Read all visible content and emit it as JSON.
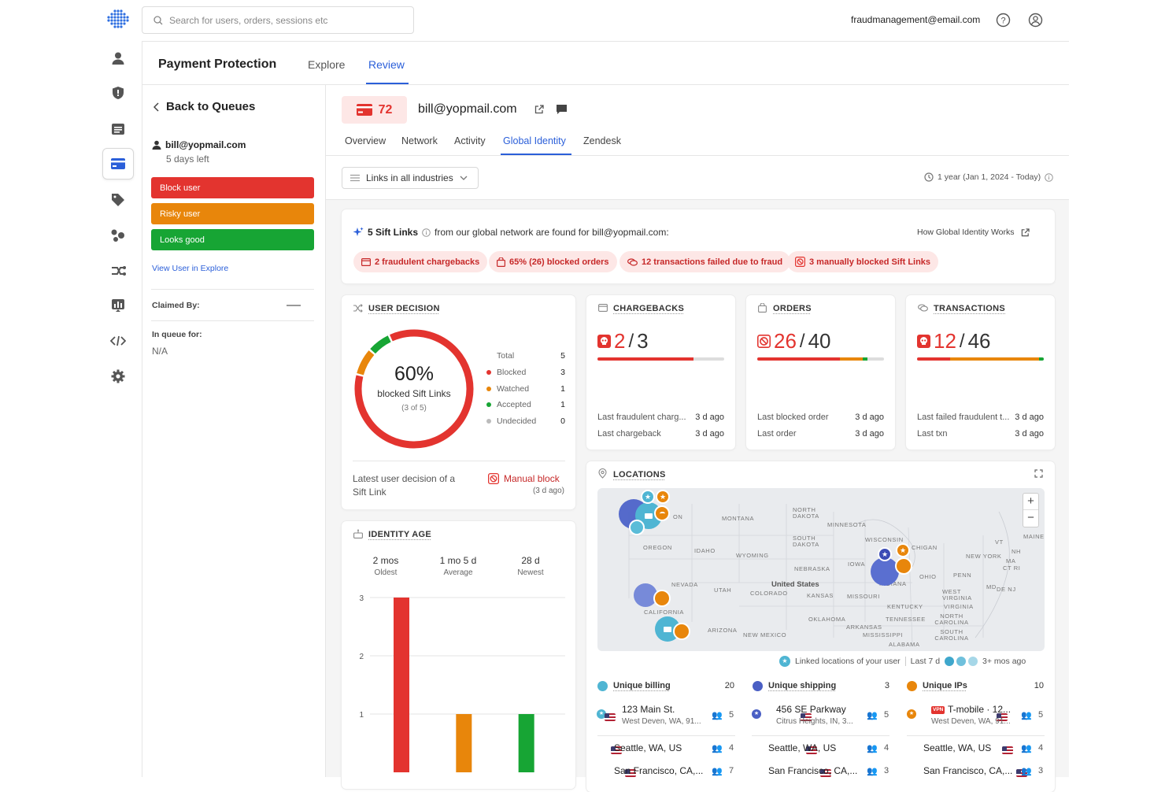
{
  "header": {
    "search_placeholder": "Search for users, orders, sessions etc",
    "account_email": "fraudmanagement@email.com"
  },
  "nav": {
    "product": "Payment Protection",
    "tabs": [
      "Explore",
      "Review"
    ],
    "active_tab": "Review"
  },
  "left_panel": {
    "back_label": "Back to Queues",
    "user_email": "bill@yopmail.com",
    "days_left": "5 days left",
    "actions": {
      "block": "Block user",
      "risky": "Risky user",
      "good": "Looks good"
    },
    "view_link": "View User in Explore",
    "claimed_by_label": "Claimed By:",
    "claimed_by_value": "—",
    "in_queue_label": "In queue for:",
    "in_queue_value": "N/A"
  },
  "user_header": {
    "score": "72",
    "email": "bill@yopmail.com",
    "tabs": [
      "Overview",
      "Network",
      "Activity",
      "Global Identity",
      "Zendesk"
    ],
    "active_tab": "Global Identity"
  },
  "filters": {
    "industry": "Links in all industries",
    "date_range": "1 year (Jan 1, 2024 - Today)"
  },
  "summary": {
    "links_count": "5 Sift Links",
    "text": "from our global network are found for bill@yopmail.com:",
    "how_link": "How Global Identity Works",
    "pills": [
      "2 fraudulent chargebacks",
      "65% (26) blocked orders",
      "12 transactions failed due to fraud",
      "3 manually blocked Sift Links"
    ]
  },
  "user_decision": {
    "title": "USER DECISION",
    "percent": "60%",
    "caption": "blocked Sift Links",
    "sub": "(3 of 5)",
    "legend": [
      {
        "label": "Total",
        "value": "5",
        "color": ""
      },
      {
        "label": "Blocked",
        "value": "3",
        "color": "#e3342f"
      },
      {
        "label": "Watched",
        "value": "1",
        "color": "#e8860b"
      },
      {
        "label": "Accepted",
        "value": "1",
        "color": "#17a534"
      },
      {
        "label": "Undecided",
        "value": "0",
        "color": "#bbbbbb"
      }
    ],
    "latest_label": "Latest user decision of a Sift Link",
    "latest_value": "Manual block",
    "latest_time": "(3 d ago)"
  },
  "stats": {
    "chargebacks": {
      "title": "CHARGEBACKS",
      "num": "2",
      "den": "3",
      "rows": [
        [
          "Last fraudulent charg...",
          "3 d ago"
        ],
        [
          "Last chargeback",
          "3 d ago"
        ]
      ]
    },
    "orders": {
      "title": "ORDERS",
      "num": "26",
      "den": "40",
      "rows": [
        [
          "Last blocked order",
          "3 d ago"
        ],
        [
          "Last order",
          "3 d ago"
        ]
      ]
    },
    "transactions": {
      "title": "TRANSACTIONS",
      "num": "12",
      "den": "46",
      "rows": [
        [
          "Last failed fraudulent t...",
          "3 d ago"
        ],
        [
          "Last txn",
          "3 d ago"
        ]
      ]
    }
  },
  "identity_age": {
    "title": "IDENTITY AGE",
    "stats": [
      {
        "value": "2 mos",
        "label": "Oldest"
      },
      {
        "value": "1 mo 5 d",
        "label": "Average"
      },
      {
        "value": "28 d",
        "label": "Newest"
      }
    ]
  },
  "chart_data": {
    "type": "bar",
    "title": "",
    "xlabel": "",
    "ylabel": "",
    "y_ticks": [
      1,
      2,
      3
    ],
    "ylim": [
      0,
      3
    ],
    "series_colors": [
      "#e3342f",
      "#e8860b",
      "#17a534"
    ],
    "values": [
      3,
      1,
      1
    ]
  },
  "locations": {
    "title": "LOCATIONS",
    "map_labels": [
      "NORTH DAKOTA",
      "MONTANA",
      "MINNESOTA",
      "SOUTH DAKOTA",
      "WISCONSIN",
      "OREGON",
      "IDAHO",
      "WYOMING",
      "NEBRASKA",
      "IOWA",
      "NEVADA",
      "UTAH",
      "United States",
      "COLORADO",
      "KANSAS",
      "MISSOURI",
      "CALIFORNIA",
      "OKLAHOMA",
      "ARKANSAS",
      "ARIZONA",
      "NEW MEXICO",
      "MISSISSIPPI",
      "ALABAMA",
      "TENNESSEE",
      "KENTUCKY",
      "INDIANA",
      "OHIO",
      "WEST VIRGINIA",
      "VIRGINIA",
      "NORTH CAROLINA",
      "SOUTH CAROLINA",
      "PENN",
      "NEW YORK",
      "VT",
      "NH",
      "MA",
      "CT RI",
      "MAINE",
      "MD",
      "DE NJ",
      "CHIGAN",
      "ON"
    ],
    "legend_linked": "Linked locations of your user",
    "legend_last": "Last 7 d",
    "legend_old": "3+ mos ago",
    "columns": [
      {
        "title": "Unique billing",
        "count": "20",
        "top": {
          "line1": "123 Main St.",
          "line2": "West Deven, WA, 91...",
          "n": "5"
        },
        "rows": [
          {
            "name": "Seattle, WA, US",
            "n": "4"
          },
          {
            "name": "San Francisco, CA,...",
            "n": "7"
          }
        ]
      },
      {
        "title": "Unique shipping",
        "count": "3",
        "top": {
          "line1": "456 SE Parkway",
          "line2": "Citrus Heights, IN, 3...",
          "n": "5"
        },
        "rows": [
          {
            "name": "Seattle, WA, US",
            "n": "4"
          },
          {
            "name": "San Francisco, CA,...",
            "n": "3"
          }
        ]
      },
      {
        "title": "Unique IPs",
        "count": "10",
        "top": {
          "line1": "T-mobile · 12...",
          "line2": "West Deven, WA, 91...",
          "n": "5",
          "badge": "VPN"
        },
        "rows": [
          {
            "name": "Seattle, WA, US",
            "n": "4"
          },
          {
            "name": "San Francisco, CA,...",
            "n": "3"
          }
        ]
      }
    ]
  }
}
